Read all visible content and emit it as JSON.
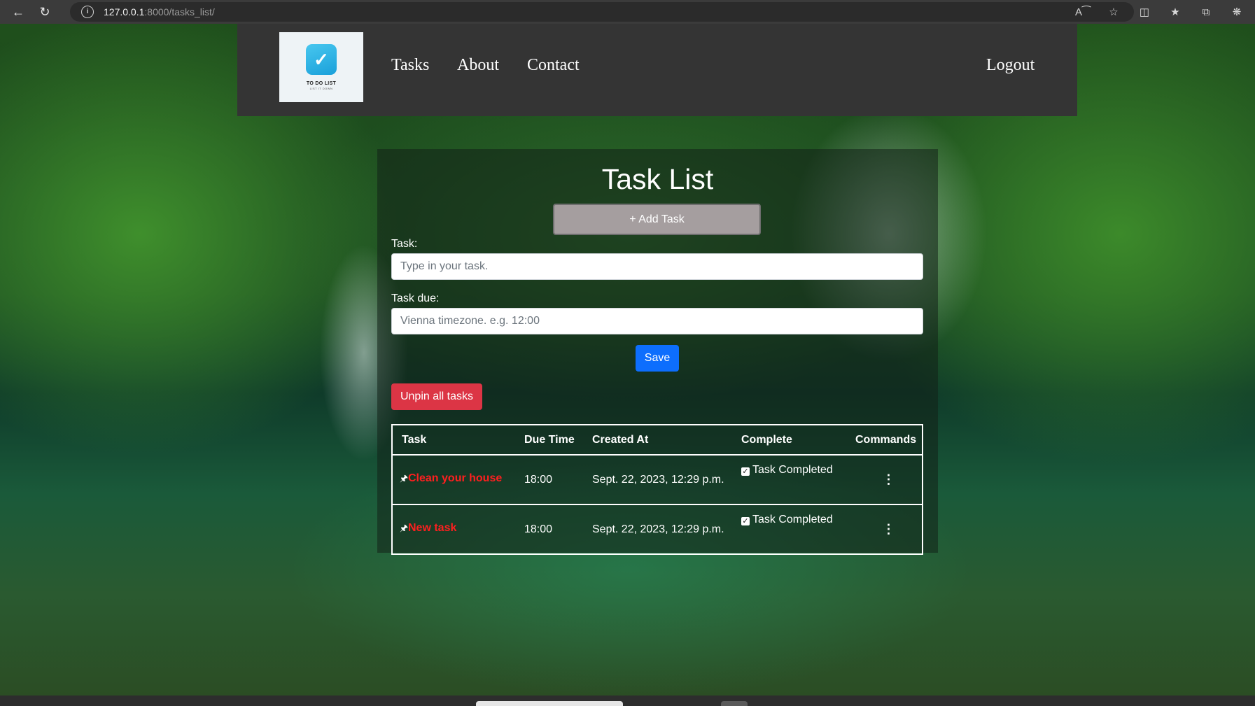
{
  "browser": {
    "url_host": "127.0.0.1",
    "url_rest": ":8000/tasks_list/",
    "icons": [
      "back-icon",
      "reload-icon",
      "info-icon",
      "read-aloud-icon",
      "favorite-star-icon",
      "split-screen-icon",
      "favorites-icon",
      "collections-icon",
      "extensions-icon"
    ]
  },
  "navbar": {
    "logo_text": "TO DO LIST",
    "logo_subtext": "LIST IT DOWN",
    "links": [
      "Tasks",
      "About",
      "Contact"
    ],
    "logout": "Logout"
  },
  "main": {
    "title": "Task List",
    "add_task": "+ Add Task",
    "task_label": "Task:",
    "task_placeholder": "Type in your task.",
    "due_label": "Task due:",
    "due_placeholder": "Vienna timezone. e.g. 12:00",
    "save": "Save",
    "unpin_all": "Unpin all tasks"
  },
  "table": {
    "headers": [
      "Task",
      "Due Time",
      "Created At",
      "Complete",
      "Commands"
    ],
    "rows": [
      {
        "task": "Clean your house",
        "due": "18:00",
        "created": "Sept. 22, 2023, 12:29 p.m.",
        "complete": "Task Completed",
        "pinned": true
      },
      {
        "task": "New task",
        "due": "18:00",
        "created": "Sept. 22, 2023, 12:29 p.m.",
        "complete": "Task Completed",
        "pinned": true
      }
    ]
  },
  "colors": {
    "navbar_bg": "#343434",
    "add_button_bg": "#a59e9f",
    "save_button_bg": "#0d6efd",
    "unpin_button_bg": "#dc3545",
    "task_name_color": "#ff1f1f"
  }
}
